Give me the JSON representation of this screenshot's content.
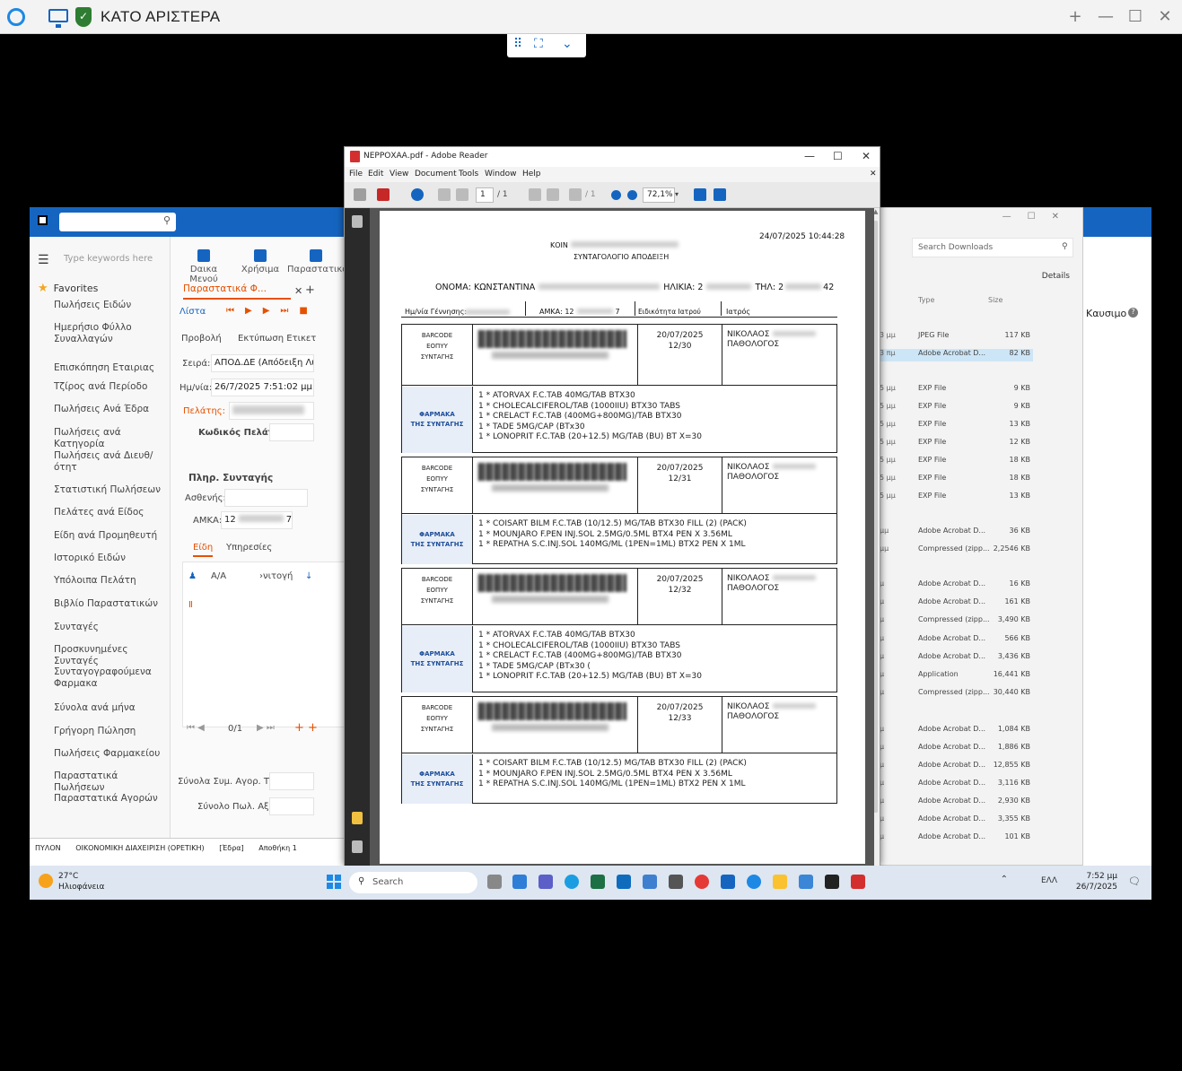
{
  "remote": {
    "title": "ΚΑΤΟ ΑΡΙΣΤΕΡΑ",
    "min": "—",
    "restore": "☐",
    "close": "✕",
    "plus": "+"
  },
  "remote_toolbar": {
    "grid": "⠿",
    "expand": "⛶",
    "chevron": "⌄"
  },
  "erp": {
    "search_icon": "⚲",
    "sidebar_search_placeholder": "Type keywords here",
    "favorites": "Favorites",
    "nav": [
      "Πωλήσεις Ειδών",
      "Ημερήσιο Φύλλο Συναλλαγών",
      "Επισκόπηση Εταιριας",
      "Τζίρος ανά Περίοδο",
      "Πωλήσεις Ανά Έδρα",
      "Πωλήσεις ανά Κατηγορία",
      "Πωλήσεις ανά Διευθ/ότητ",
      "Στατιστική Πωλήσεων",
      "Πελάτες ανά Είδος",
      "Είδη ανά Προμηθευτή",
      "Ιστορικό Ειδών",
      "Υπόλοιπα Πελάτη",
      "Βιβλίο Παραστατικών",
      "Συνταγές",
      "Προσκυνημένες Συνταγές",
      "Συνταγογραφούμενα Φαρμακα",
      "Σύνολα ανά μήνα",
      "Γρήγορη Πώληση",
      "Πωλήσεις Φαρμακείου",
      "Παραστατικά Πωλήσεων",
      "Παραστατικά Αγορών"
    ],
    "ribbon": [
      "Dαικα Μενού",
      "Χρήσιμα",
      "Παραστατικά"
    ],
    "doc_tab": "Παραστατικά Φ...",
    "list_label": "Λίστα",
    "view_label": "Προβολή",
    "print_label": "Εκτύπωση Ετικετ",
    "series_label": "Σειρά:",
    "series_value": "ΑΠΟΔ.ΔΕ (Απόδειξη Λιαν.",
    "date_label": "Ημ/νία:",
    "date_value": "26/7/2025 7:51:02 μμ",
    "customer_label": "Πελάτης:",
    "customer_code_label": "Κωδικός Πελάτη:",
    "prescription_section": "Πληρ. Συνταγής",
    "patient_label": "Ασθενής:",
    "amka_label": "ΑΜΚΑ:",
    "amka_start": "12",
    "amka_end": "7",
    "tab_items": "Είδη",
    "tab_services": "Υπηρεσίες",
    "col_aa": "Α/Α",
    "col_code": "›νιτογή",
    "pager": "0/1",
    "total_purchase": "Σύνολα Συμ. Αγορ. Ταμ.",
    "total_sales": "Σύνολο Πωλ. Αξία",
    "status": [
      "ΠΥΛΟΝ",
      "ΟΙΚΟΝΟΜΙΚΗ ΔΙΑΧΕΙΡΙΣΗ (ΟΡΕΤΙΚΗ)",
      "[Έδρα]",
      "Αποθήκη 1"
    ]
  },
  "explorer": {
    "search_placeholder": "Search Downloads",
    "details": "Details",
    "col_type": "Type",
    "col_size": "Size",
    "rows": [
      {
        "type": "JPEG File",
        "size": "117 KB"
      },
      {
        "type": "Adobe Acrobat D...",
        "size": "82 KB"
      },
      {
        "type": "EXP File",
        "size": "9 KB"
      },
      {
        "type": "EXP File",
        "size": "9 KB"
      },
      {
        "type": "EXP File",
        "size": "13 KB"
      },
      {
        "type": "EXP File",
        "size": "12 KB"
      },
      {
        "type": "EXP File",
        "size": "18 KB"
      },
      {
        "type": "EXP File",
        "size": "18 KB"
      },
      {
        "type": "EXP File",
        "size": "13 KB"
      },
      {
        "type": "Adobe Acrobat D...",
        "size": "36 KB"
      },
      {
        "type": "Compressed (zipp...",
        "size": "2,2546 KB"
      },
      {
        "type": "Adobe Acrobat D...",
        "size": "16 KB"
      },
      {
        "type": "Adobe Acrobat D...",
        "size": "161 KB"
      },
      {
        "type": "Compressed (zipp...",
        "size": "3,490 KB"
      },
      {
        "type": "Adobe Acrobat D...",
        "size": "566 KB"
      },
      {
        "type": "Adobe Acrobat D...",
        "size": "3,436 KB"
      },
      {
        "type": "Application",
        "size": "16,441 KB"
      },
      {
        "type": "Compressed (zipp...",
        "size": "30,440 KB"
      },
      {
        "type": "Adobe Acrobat D...",
        "size": "1,084 KB"
      },
      {
        "type": "Adobe Acrobat D...",
        "size": "1,886 KB"
      },
      {
        "type": "Adobe Acrobat D...",
        "size": "12,855 KB"
      },
      {
        "type": "Adobe Acrobat D...",
        "size": "3,116 KB"
      },
      {
        "type": "Adobe Acrobat D...",
        "size": "2,930 KB"
      },
      {
        "type": "Adobe Acrobat D...",
        "size": "3,355 KB"
      },
      {
        "type": "Adobe Acrobat D...",
        "size": "101 KB"
      }
    ],
    "row_dates": [
      "3 μμ",
      "3 πμ",
      "5 μμ",
      "5 μμ",
      "5 μμ",
      "5 μμ",
      "5 μμ",
      "5 μμ",
      "5 μμ",
      "μμ",
      "μμ",
      "μ",
      "μ",
      "μ",
      "μ",
      "μ",
      "μ",
      "μ",
      "μ",
      "μ",
      "μ",
      "μ",
      "μ",
      "μ",
      "μ"
    ]
  },
  "blue_right": {
    "label": "Καυσιμο"
  },
  "adobe": {
    "title": "ΝΕΡΡΟΧΑΑ.pdf - Adobe Reader",
    "menu": [
      "File",
      "Edit",
      "View",
      "Document",
      "Tools",
      "Window",
      "Help"
    ],
    "page_current": "1",
    "page_total": "/ 1",
    "page_total2": "/ 1",
    "zoom": "72,1%"
  },
  "pdf": {
    "timestamp": "24/07/2025 10:44:28",
    "header1": "ΚΟΙΝ",
    "header2": "ΣΥΝΤΑΓΟΛΟΓΙΟ ΑΠΟΔΕΙΞΗ",
    "name_label": "ΟΝΟΜΑ: ΚΩΝΣΤΑΝΤΙΝΑ",
    "age_label": "ΗΛΙΚΙΑ: 2",
    "tel_label": "ΤΗΛ: 2",
    "tel_end": "42",
    "col_birth": "Ημ/νία Γέννησης:",
    "col_amka": "ΑΜΚΑ: 12",
    "col_amka_end": "7",
    "col_spec": "Ειδικότητα Ιατρού",
    "col_doctor": "Ιατρός",
    "barcode_label": [
      "BARCODE",
      "ΕΟΠΥΥ",
      "ΣΥΝΤΑΓΗΣ"
    ],
    "drugs_label": [
      "ΦΑΡΜΑΚΑ",
      "ΤΗΣ ΣΥΝΤΑΓΗΣ"
    ],
    "doctor": [
      "ΝΙΚΟΛΑΟΣ",
      "ΠΑΘΟΛΟΓΟΣ"
    ],
    "prescriptions": [
      {
        "date": "20/07/2025",
        "seq": "12/30",
        "meds": [
          "1 * ATORVAX F.C.TAB 40MG/TAB BTX30",
          "1 * CHOLECALCIFEROL/TAB (1000IIU) BTX30 TABS",
          "1 * CRELACT F.C.TAB (400MG+800MG)/TAB BTX30",
          "1 * TADE 5MG/CAP (BTx30",
          "1 * LONOPRIT F.C.TAB (20+12.5) MG/TAB (BU) BT X=30"
        ]
      },
      {
        "date": "20/07/2025",
        "seq": "12/31",
        "meds": [
          "1 * COISART BILM F.C.TAB (10/12.5) MG/TAB BTX30 FILL (2) (PACK)",
          "1 * MOUNJARO F.PEN INJ.SOL 2.5MG/0.5ML BTX4 PEN X 3.56ML",
          "1 * REPATHA S.C.INJ.SOL 140MG/ML (1PEN=1ML) BTX2 PEN X 1ML"
        ]
      },
      {
        "date": "20/07/2025",
        "seq": "12/32",
        "meds": [
          "1 * ATORVAX F.C.TAB 40MG/TAB BTX30",
          "1 * CHOLECALCIFEROL/TAB (1000IIU) BTX30 TABS",
          "1 * CRELACT F.C.TAB (400MG+800MG)/TAB BTX30",
          "1 * TADE 5MG/CAP (BTx30 (",
          "1 * LONOPRIT F.C.TAB (20+12.5) MG/TAB (BU) BT X=30"
        ]
      },
      {
        "date": "20/07/2025",
        "seq": "12/33",
        "meds": [
          "1 * COISART BILM F.C.TAB (10/12.5) MG/TAB BTX30 FILL (2) (PACK)",
          "1 * MOUNJARO F.PEN INJ.SOL 2.5MG/0.5ML BTX4 PEN X 3.56ML",
          "1 * REPATHA S.C.INJ.SOL 140MG/ML (1PEN=1ML) BTX2 PEN X 1ML"
        ]
      }
    ]
  },
  "taskbar": {
    "temp": "27°C",
    "weather": "Ηλιοφάνεια",
    "search": "Search",
    "time": "7:52 μμ",
    "date": "26/7/2025",
    "tray": "ΕΛΛ"
  }
}
